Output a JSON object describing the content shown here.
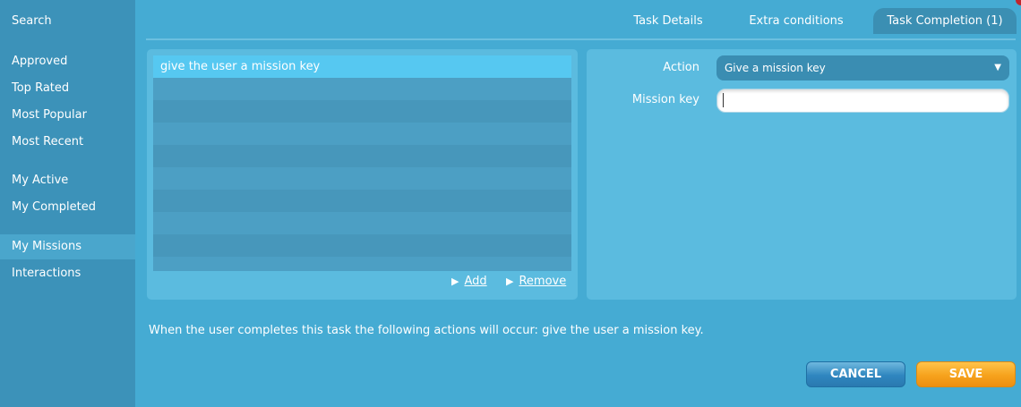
{
  "sidebar": {
    "items": [
      {
        "label": "Search"
      },
      {
        "label": "Approved"
      },
      {
        "label": "Top Rated"
      },
      {
        "label": "Most Popular"
      },
      {
        "label": "Most Recent"
      },
      {
        "label": "My Active"
      },
      {
        "label": "My Completed"
      },
      {
        "label": "My Missions"
      },
      {
        "label": "Interactions"
      }
    ]
  },
  "tabs": [
    {
      "label": "Task Details"
    },
    {
      "label": "Extra conditions"
    },
    {
      "label": "Task Completion (1)"
    }
  ],
  "actions_list": {
    "items": [
      "give the user a mission key"
    ],
    "add_label": "Add",
    "remove_label": "Remove"
  },
  "form": {
    "action_label": "Action",
    "action_value": "Give a mission key",
    "mission_key_label": "Mission key",
    "mission_key_value": ""
  },
  "summary": "When the user completes this task the following actions will occur: give the user a mission key.",
  "buttons": {
    "cancel": "CANCEL",
    "save": "SAVE"
  },
  "icons": {
    "add": "play-arrow-icon",
    "remove": "play-arrow-icon",
    "select": "caret-down-icon"
  },
  "colors": {
    "sidebar_bg": "#3c92b9",
    "main_bg": "#45abd3",
    "selected_row": "#56c8f1",
    "cancel_button": "#2f86bf",
    "save_button": "#f6a21d"
  }
}
